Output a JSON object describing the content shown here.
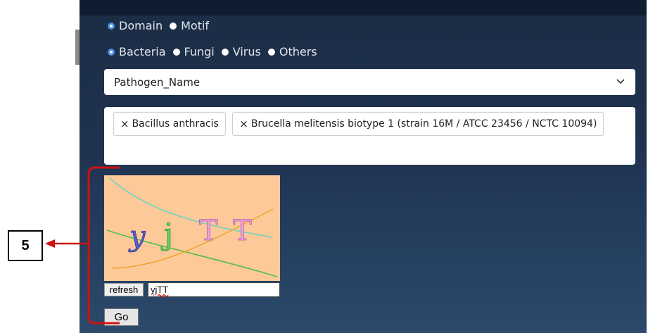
{
  "domain_radios": [
    {
      "label": "Domain",
      "checked": true
    },
    {
      "label": "Motif",
      "checked": false
    }
  ],
  "organism_radios": [
    {
      "label": "Bacteria",
      "checked": true
    },
    {
      "label": "Fungi",
      "checked": false
    },
    {
      "label": "Virus",
      "checked": false
    },
    {
      "label": "Others",
      "checked": false
    }
  ],
  "pathogen_select": {
    "value": "Pathogen_Name",
    "icon": "chevron-down-icon"
  },
  "selected_tags": [
    {
      "remove_icon": "×",
      "label": "Bacillus anthracis"
    },
    {
      "remove_icon": "×",
      "label": "Brucella melitensis biotype 1 (strain 16M / ATCC 23456 / NCTC 10094)"
    }
  ],
  "captcha": {
    "chars": [
      "y",
      "j",
      "T",
      "T"
    ],
    "background": "#fdc999"
  },
  "refresh_label": "refresh",
  "captcha_input_value": "yjTT",
  "go_label": "Go",
  "annotation": {
    "number": "5",
    "color": "#d01010"
  }
}
